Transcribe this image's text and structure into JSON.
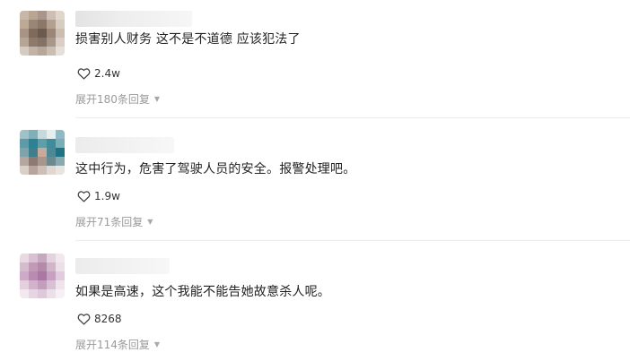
{
  "comments": [
    {
      "text": "损害别人财务 这不是不道德 应该犯法了",
      "likes": "2.4w",
      "expand": "展开180条回复",
      "avatar_colors": [
        "#c8b7a8",
        "#b9a592",
        "#a9958a",
        "#cdbfb3",
        "#e0d6cc",
        "#bda995",
        "#9a8675",
        "#8c7868",
        "#b4a08e",
        "#d8ccc1",
        "#a89385",
        "#7f6a5c",
        "#6d5a4e",
        "#9b8678",
        "#cbbdb0",
        "#b6a497",
        "#8e7a6c",
        "#867264",
        "#a8968a",
        "#d9cfc6",
        "#d5cbc1",
        "#c2b3a6",
        "#b7a699",
        "#cabdb1",
        "#e6dfd8"
      ]
    },
    {
      "text": "这中行为，危害了驾驶人员的安全。报警处理吧。",
      "likes": "1.9w",
      "expand": "展开71条回复",
      "avatar_colors": [
        "#9fc2c9",
        "#7fb0ba",
        "#c6dade",
        "#e6eef0",
        "#8dbac3",
        "#5f9aa6",
        "#2f8191",
        "#5d9ea9",
        "#3f8c9b",
        "#79aeb8",
        "#7fa3a8",
        "#3f7f8c",
        "#c9a99a",
        "#4d8994",
        "#1f7383",
        "#b5a79f",
        "#8d7a70",
        "#a7968c",
        "#6b8a8f",
        "#8aa9ae",
        "#d9cec8",
        "#b7a49a",
        "#cdbfb7",
        "#e1d7d1",
        "#eae4e0"
      ]
    },
    {
      "text": "如果是高速，这个我能不能告她故意杀人呢。",
      "likes": "8268",
      "expand": "展开114条回复",
      "avatar_colors": [
        "#e8d9e3",
        "#d9c1d3",
        "#c7a8c0",
        "#e3d3df",
        "#f1e8ee",
        "#d5bccd",
        "#c19ab8",
        "#b48aac",
        "#d2b5cb",
        "#ecdfe8",
        "#cfa9c8",
        "#b98bb2",
        "#a978a3",
        "#c7a0c2",
        "#e2cbdc",
        "#e3cfdd",
        "#d1b3cb",
        "#c49ebf",
        "#d9c1d5",
        "#efe4ec",
        "#f2e9ef",
        "#e6d6e2",
        "#dccadb",
        "#ebdfe8",
        "#f6f0f4"
      ]
    }
  ],
  "icons": {
    "like": "heart-outline-icon",
    "expand": "caret-down-icon"
  }
}
